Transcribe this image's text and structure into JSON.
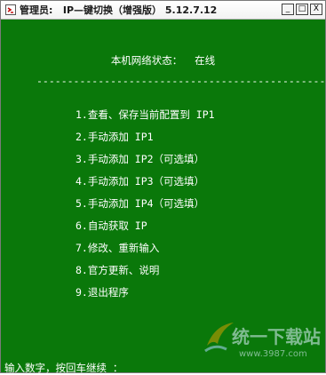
{
  "window": {
    "title": "管理员:   IP—键切换（增强版） 5.12.7.12",
    "buttons": {
      "minimize": "_",
      "maximize": "□",
      "close": "X"
    }
  },
  "console": {
    "status_line": "本机网络状态：  在线",
    "divider": "------------------------------------------------",
    "menu": [
      "1.查看、保存当前配置到 IP1",
      "2.手动添加 IP1",
      "3.手动添加 IP2（可选填）",
      "4.手动添加 IP3（可选填）",
      "5.手动添加 IP4（可选填）",
      "6.自动获取 IP",
      "7.修改、重新输入",
      "8.官方更新、说明",
      "9.退出程序"
    ],
    "prompt": "输入数字，按回车继续 ："
  },
  "watermark": {
    "text": "统一下载站",
    "url": "www.3987.com"
  },
  "colors": {
    "console_bg": "#0a780a",
    "console_fg": "#ffffff",
    "titlebar_bg": "#f4f4f4"
  },
  "icons": {
    "app": "cmd-window-icon",
    "watermark": "swallow-logo-icon"
  }
}
